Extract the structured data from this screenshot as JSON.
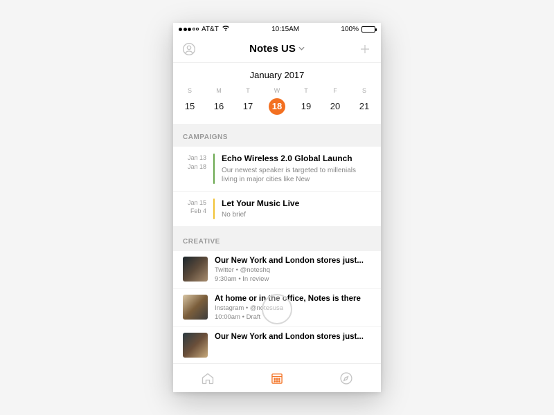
{
  "status": {
    "carrier": "AT&T",
    "time": "10:15AM",
    "battery": "100%"
  },
  "nav": {
    "title": "Notes US"
  },
  "calendar": {
    "month": "January 2017",
    "dow": [
      "S",
      "M",
      "T",
      "W",
      "T",
      "F",
      "S"
    ],
    "days": [
      "15",
      "16",
      "17",
      "18",
      "19",
      "20",
      "21"
    ],
    "selected": "18"
  },
  "sections": {
    "campaigns_label": "CAMPAIGNS",
    "creative_label": "CREATIVE"
  },
  "campaigns": [
    {
      "start": "Jan 13",
      "end": "Jan 18",
      "title": "Echo Wireless 2.0 Global Launch",
      "desc": "Our newest speaker is targeted to millenials living in major cities like New",
      "color": "#6aa84f"
    },
    {
      "start": "Jan 15",
      "end": "Feb 4",
      "title": "Let Your Music Live",
      "desc": "No brief",
      "color": "#f1c232"
    }
  ],
  "creative": [
    {
      "title": "Our New York and London stores just...",
      "meta": "Twitter • @noteshq",
      "meta2": "9:30am • In review",
      "thumb_colors": [
        "#1b262c",
        "#5c4a3a",
        "#a78c6e"
      ]
    },
    {
      "title": "At home or in the office, Notes is there",
      "meta": "Instagram • @notesusa",
      "meta2": "10:00am • Draft",
      "thumb_colors": [
        "#d9c6a5",
        "#7b5e3b",
        "#3d3d3d"
      ]
    },
    {
      "title": "Our New York and London stores just...",
      "meta": "",
      "meta2": "",
      "thumb_colors": [
        "#2b3a42",
        "#6b4f3a",
        "#c7a97b"
      ]
    }
  ]
}
